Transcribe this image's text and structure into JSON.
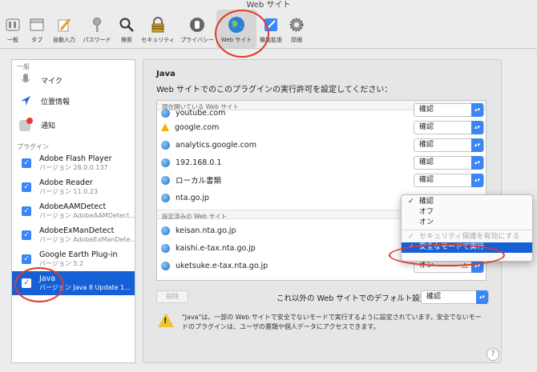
{
  "window_title": "Web サイト",
  "toolbar": [
    {
      "id": "general",
      "label": "一般",
      "icon": "switch-icon"
    },
    {
      "id": "tabs",
      "label": "タブ",
      "icon": "tabs-icon"
    },
    {
      "id": "autofill",
      "label": "自動入力",
      "icon": "pencil-icon"
    },
    {
      "id": "passwords",
      "label": "パスワード",
      "icon": "key-icon"
    },
    {
      "id": "search",
      "label": "検索",
      "icon": "magnifier-icon"
    },
    {
      "id": "security",
      "label": "セキュリティ",
      "icon": "lock-icon"
    },
    {
      "id": "privacy",
      "label": "プライバシー",
      "icon": "hand-icon"
    },
    {
      "id": "websites",
      "label": "Web サイト",
      "icon": "globe-icon"
    },
    {
      "id": "extensions",
      "label": "機能拡張",
      "icon": "puzzle-icon"
    },
    {
      "id": "advanced",
      "label": "詳細",
      "icon": "gear-icon"
    }
  ],
  "sidebar": {
    "general_header": "一般",
    "general_items": [
      {
        "label": "マイク",
        "icon": "microphone-icon"
      },
      {
        "label": "位置情報",
        "icon": "location-arrow-icon"
      },
      {
        "label": "通知",
        "icon": "notification-icon"
      }
    ],
    "plugins_header": "プラグイン",
    "plugins": [
      {
        "name": "Adobe Flash Player",
        "version": "バージョン 28.0.0.137"
      },
      {
        "name": "Adobe Reader",
        "version": "バージョン 11.0.23"
      },
      {
        "name": "AdobeAAMDetect",
        "version": "バージョン AdobeAAMDetect..."
      },
      {
        "name": "AdobeExManDetect",
        "version": "バージョン AdobeExManDete..."
      },
      {
        "name": "Google Earth Plug-in",
        "version": "バージョン 5.2"
      },
      {
        "name": "Java",
        "version": "バージョン Java 8 Update 1..."
      }
    ]
  },
  "main": {
    "title": "Java",
    "description": "Web サイトでのこのプラグインの実行許可を設定してください：",
    "open_header": "現在開いている Web サイト",
    "open_sites": [
      {
        "name": "youtube.com",
        "value": "確認",
        "icon": "globe-icon"
      },
      {
        "name": "google.com",
        "value": "確認",
        "icon": "google-drive-icon"
      },
      {
        "name": "analytics.google.com",
        "value": "確認",
        "icon": "globe-icon"
      },
      {
        "name": "192.168.0.1",
        "value": "確認",
        "icon": "globe-icon"
      },
      {
        "name": "ローカル書類",
        "value": "確認",
        "icon": "globe-icon"
      },
      {
        "name": "nta.go.jp",
        "value": "",
        "icon": "globe-icon"
      }
    ],
    "configured_header": "設定済みの Web サイト",
    "configured_sites": [
      {
        "name": "keisan.nta.go.jp",
        "value": "",
        "icon": "globe-icon"
      },
      {
        "name": "kaishi.e-tax.nta.go.jp",
        "value": "",
        "icon": "globe-icon"
      },
      {
        "name": "uketsuke.e-tax.nta.go.jp",
        "value": "オン",
        "icon": "globe-icon"
      }
    ],
    "delete_label": "削除",
    "default_label": "これ以外の Web サイトでのデフォルト設定：",
    "default_value": "確認",
    "note": "\"Java\"は、一部の Web サイトで安全でないモードで実行するように設定されています。安全でないモードのプラグインは、ユーザの書類や個人データにアクセスできます。"
  },
  "popup": {
    "items": [
      {
        "label": "確認",
        "checked": true,
        "state": "normal"
      },
      {
        "label": "オフ",
        "checked": false,
        "state": "normal"
      },
      {
        "label": "オン",
        "checked": false,
        "state": "normal"
      },
      {
        "label": "セキュリティ保護を有効にする",
        "checked": true,
        "state": "disabled"
      },
      {
        "label": "安全なモードで実行",
        "checked": true,
        "state": "highlighted"
      }
    ]
  },
  "help_label": "?",
  "colors": {
    "accent": "#1560d6",
    "select_arrow": "#3a86f5",
    "annotation": "#e03a2a",
    "warning": "#f1c232"
  }
}
